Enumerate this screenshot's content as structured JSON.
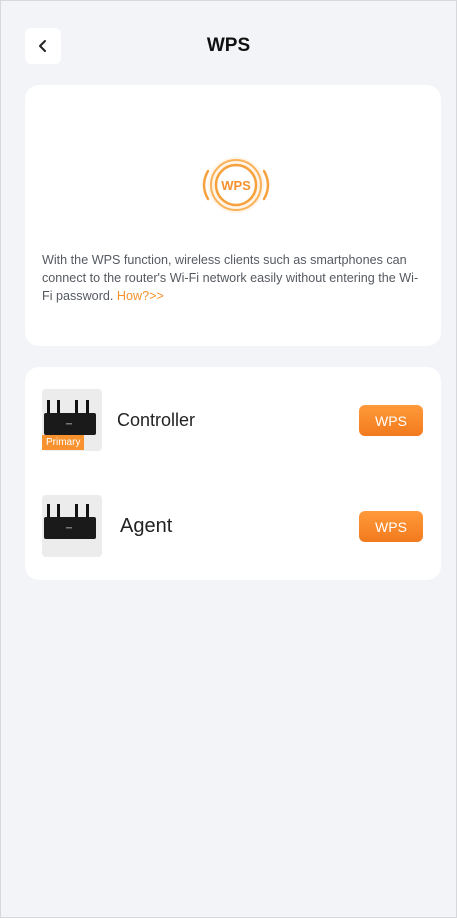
{
  "header": {
    "title": "WPS",
    "back_icon": "chevron-left-icon"
  },
  "intro": {
    "icon_label": "WPS",
    "description": "With the WPS function, wireless clients such as smartphones can connect to the router's Wi-Fi network easily without entering the Wi-Fi password.",
    "link_text": "How?>>"
  },
  "devices": [
    {
      "name": "Controller",
      "badge": "Primary",
      "button_label": "WPS"
    },
    {
      "name": "Agent",
      "button_label": "WPS"
    }
  ],
  "colors": {
    "accent": "#f7922e",
    "background": "#f2f4f7",
    "card": "#ffffff"
  }
}
